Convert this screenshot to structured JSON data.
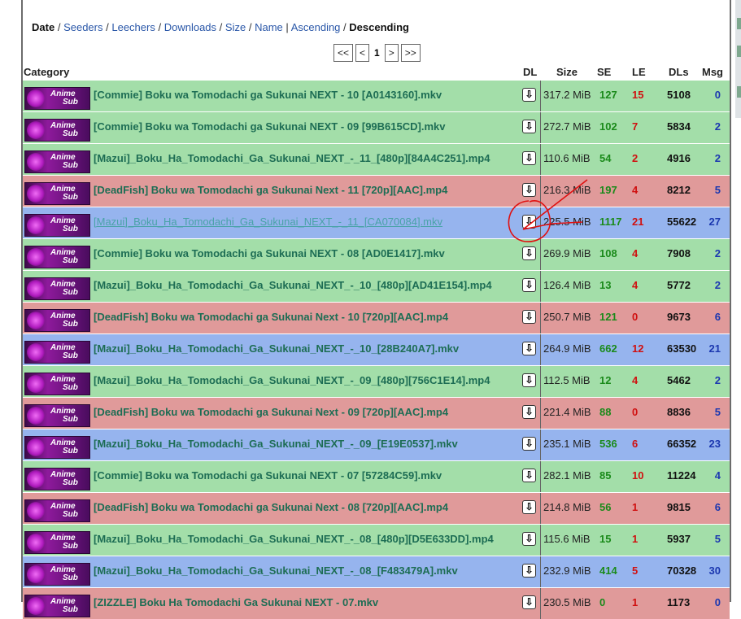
{
  "sort": {
    "date": "Date",
    "seeders": "Seeders",
    "leechers": "Leechers",
    "downloads": "Downloads",
    "size": "Size",
    "name": "Name",
    "ascending": "Ascending",
    "descending": "Descending",
    "slash": "/",
    "pipe": "|"
  },
  "pager": {
    "first": "<<",
    "prev": "<",
    "current": "1",
    "next": ">",
    "last": ">>"
  },
  "columns": {
    "category": "Category",
    "dl": "DL",
    "size": "Size",
    "se": "SE",
    "le": "LE",
    "dls": "DLs",
    "msg": "Msg"
  },
  "category_badge": {
    "line1": "Anime",
    "line2": "Sub"
  },
  "dl_icon_glyph": "⇩",
  "rows": [
    {
      "name": "[Commie] Boku wa Tomodachi ga Sukunai NEXT - 10 [A0143160].mkv",
      "size": "317.2 MiB",
      "se": "127",
      "le": "15",
      "dls": "5108",
      "msg": "0"
    },
    {
      "name": "[Commie] Boku wa Tomodachi ga Sukunai NEXT - 09 [99B615CD].mkv",
      "size": "272.7 MiB",
      "se": "102",
      "le": "7",
      "dls": "5834",
      "msg": "2"
    },
    {
      "name": "[Mazui]_Boku_Ha_Tomodachi_Ga_Sukunai_NEXT_-_11_[480p][84A4C251].mp4",
      "size": "110.6 MiB",
      "se": "54",
      "le": "2",
      "dls": "4916",
      "msg": "2"
    },
    {
      "name": "[DeadFish] Boku wa Tomodachi ga Sukunai Next - 11 [720p][AAC].mp4",
      "size": "216.3 MiB",
      "se": "197",
      "le": "4",
      "dls": "8212",
      "msg": "5"
    },
    {
      "name": "[Mazui]_Boku_Ha_Tomodachi_Ga_Sukunai_NEXT_-_11_[CA070084].mkv",
      "size": "225.5 MiB",
      "se": "1117",
      "le": "21",
      "dls": "55622",
      "msg": "27"
    },
    {
      "name": "[Commie] Boku wa Tomodachi ga Sukunai NEXT - 08 [AD0E1417].mkv",
      "size": "269.9 MiB",
      "se": "108",
      "le": "4",
      "dls": "7908",
      "msg": "2"
    },
    {
      "name": "[Mazui]_Boku_Ha_Tomodachi_Ga_Sukunai_NEXT_-_10_[480p][AD41E154].mp4",
      "size": "126.4 MiB",
      "se": "13",
      "le": "4",
      "dls": "5772",
      "msg": "2"
    },
    {
      "name": "[DeadFish] Boku wa Tomodachi ga Sukunai Next - 10 [720p][AAC].mp4",
      "size": "250.7 MiB",
      "se": "121",
      "le": "0",
      "dls": "9673",
      "msg": "6"
    },
    {
      "name": "[Mazui]_Boku_Ha_Tomodachi_Ga_Sukunai_NEXT_-_10_[28B240A7].mkv",
      "size": "264.9 MiB",
      "se": "662",
      "le": "12",
      "dls": "63530",
      "msg": "21"
    },
    {
      "name": "[Mazui]_Boku_Ha_Tomodachi_Ga_Sukunai_NEXT_-_09_[480p][756C1E14].mp4",
      "size": "112.5 MiB",
      "se": "12",
      "le": "4",
      "dls": "5462",
      "msg": "2"
    },
    {
      "name": "[DeadFish] Boku wa Tomodachi ga Sukunai Next - 09 [720p][AAC].mp4",
      "size": "221.4 MiB",
      "se": "88",
      "le": "0",
      "dls": "8836",
      "msg": "5"
    },
    {
      "name": "[Mazui]_Boku_Ha_Tomodachi_Ga_Sukunai_NEXT_-_09_[E19E0537].mkv",
      "size": "235.1 MiB",
      "se": "536",
      "le": "6",
      "dls": "66352",
      "msg": "23"
    },
    {
      "name": "[Commie] Boku wa Tomodachi ga Sukunai NEXT - 07 [57284C59].mkv",
      "size": "282.1 MiB",
      "se": "85",
      "le": "10",
      "dls": "11224",
      "msg": "4"
    },
    {
      "name": "[DeadFish] Boku wa Tomodachi ga Sukunai Next - 08 [720p][AAC].mp4",
      "size": "214.8 MiB",
      "se": "56",
      "le": "1",
      "dls": "9815",
      "msg": "6"
    },
    {
      "name": "[Mazui]_Boku_Ha_Tomodachi_Ga_Sukunai_NEXT_-_08_[480p][D5E633DD].mp4",
      "size": "115.6 MiB",
      "se": "15",
      "le": "1",
      "dls": "5937",
      "msg": "5"
    },
    {
      "name": "[Mazui]_Boku_Ha_Tomodachi_Ga_Sukunai_NEXT_-_08_[F483479A].mkv",
      "size": "232.9 MiB",
      "se": "414",
      "le": "5",
      "dls": "70328",
      "msg": "30"
    },
    {
      "name": "[ZIZZLE] Boku Ha Tomodachi Ga Sukunai NEXT - 07.mkv",
      "size": "230.5 MiB",
      "se": "0",
      "le": "1",
      "dls": "1173",
      "msg": "0"
    }
  ],
  "colors": {
    "green_row": "#a3dea9",
    "red_row": "#e09a9a",
    "blue_row": "#96b4ee",
    "link": "#2a57a8",
    "name_text": "#1d6d54",
    "seeders": "#1a8a1a",
    "leechers": "#d01010",
    "msg": "#1c38b0",
    "annotation": "#e01010"
  }
}
